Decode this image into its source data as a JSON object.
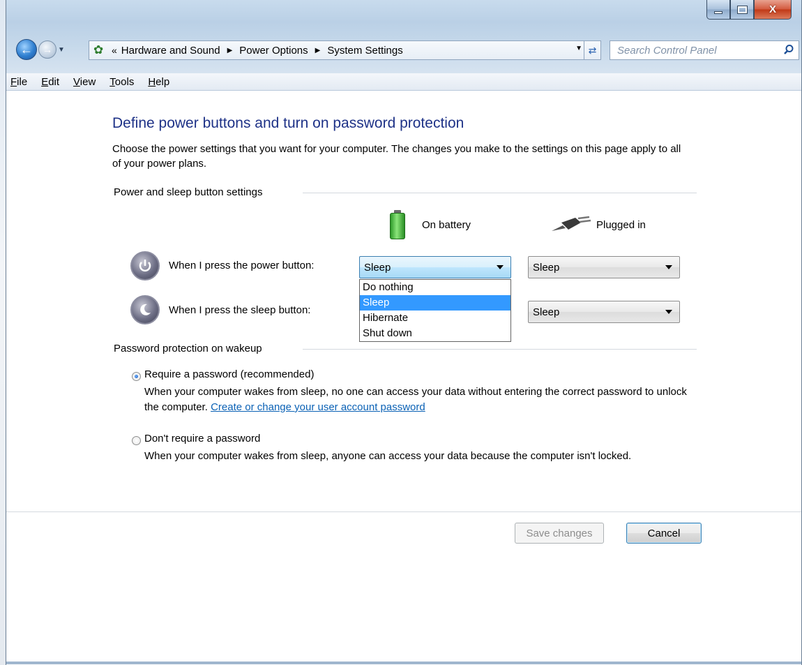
{
  "window": {
    "controls": {
      "minimize_icon": "minimize-icon",
      "maximize_icon": "maximize-icon",
      "close_label": "X"
    }
  },
  "nav": {
    "back_icon": "back-arrow-icon",
    "forward_icon": "forward-arrow-icon",
    "breadcrumb_prefix": "«",
    "breadcrumbs": [
      "Hardware and Sound",
      "Power Options",
      "System Settings"
    ],
    "search_placeholder": "Search Control Panel"
  },
  "menu": {
    "items": [
      {
        "label": "File",
        "underline": "F",
        "rest": "ile"
      },
      {
        "label": "Edit",
        "underline": "E",
        "rest": "dit"
      },
      {
        "label": "View",
        "underline": "V",
        "rest": "iew"
      },
      {
        "label": "Tools",
        "underline": "T",
        "rest": "ools"
      },
      {
        "label": "Help",
        "underline": "H",
        "rest": "elp"
      }
    ]
  },
  "page": {
    "title": "Define power buttons and turn on password protection",
    "intro": "Choose the power settings that you want for your computer. The changes you make to the settings on this page apply to all of your power plans."
  },
  "power_section": {
    "heading": "Power and sleep button settings",
    "col_battery": "On battery",
    "col_plugged": "Plugged in",
    "rows": [
      {
        "label": "When I press the power button:",
        "battery_value": "Sleep",
        "plugged_value": "Sleep"
      },
      {
        "label": "When I press the sleep button:",
        "battery_value": "Sleep",
        "plugged_value": "Sleep"
      }
    ],
    "dropdown_options": [
      "Do nothing",
      "Sleep",
      "Hibernate",
      "Shut down"
    ],
    "dropdown_selected": "Sleep"
  },
  "password_section": {
    "heading": "Password protection on wakeup",
    "require": {
      "label": "Require a password (recommended)",
      "desc": "When your computer wakes from sleep, no one can access your data without entering the correct password to unlock the computer.",
      "link": "Create or change your user account password",
      "checked": true
    },
    "no_require": {
      "label": "Don't require a password",
      "desc": "When your computer wakes from sleep, anyone can access your data because the computer isn't locked.",
      "checked": false
    }
  },
  "footer": {
    "save_label": "Save changes",
    "cancel_label": "Cancel"
  }
}
